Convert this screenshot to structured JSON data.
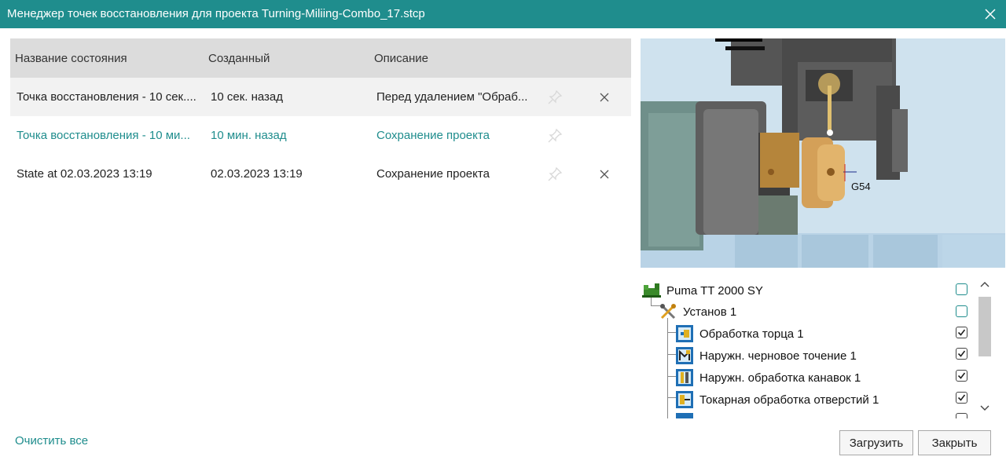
{
  "window": {
    "title": "Менеджер точек восстановления для проекта Turning-Miliing-Combo_17.stcp"
  },
  "table": {
    "headers": [
      "Название состояния",
      "Созданный",
      "Описание"
    ],
    "rows": [
      {
        "name": "Точка восстановления - 10 сек....",
        "created": "10 сек. назад",
        "description": "Перед удалением \"Обраб...",
        "selected": true,
        "deletable": true
      },
      {
        "name": "Точка восстановления - 10 ми...",
        "created": "10 мин. назад",
        "description": "Сохранение проекта",
        "selected": false,
        "deletable": false
      },
      {
        "name": "State at 02.03.2023 13:19",
        "created": "02.03.2023 13:19",
        "description": "Сохранение проекта",
        "selected": false,
        "deletable": true
      }
    ]
  },
  "preview": {
    "label": "G54"
  },
  "tree": {
    "nodes": [
      {
        "label": "Puma TT 2000 SY",
        "icon": "machine-icon",
        "checked": false
      },
      {
        "label": "Установ 1",
        "icon": "setup-tools-icon",
        "checked": false
      },
      {
        "label": "Обработка торца 1",
        "icon": "facing-operation-icon",
        "checked": true
      },
      {
        "label": "Наружн. черновое точение 1",
        "icon": "rough-turning-icon",
        "checked": true
      },
      {
        "label": "Наружн. обработка канавок 1",
        "icon": "grooving-icon",
        "checked": true
      },
      {
        "label": "Токарная обработка отверстий 1",
        "icon": "hole-turning-icon",
        "checked": true
      }
    ]
  },
  "footer": {
    "clear_all": "Очистить все",
    "load_button": "Загрузить",
    "close_button": "Закрыть"
  },
  "colors": {
    "accent": "#1f8d8d",
    "header_bg": "#dcdcdc",
    "selected_row_bg": "#f2f2f2"
  }
}
